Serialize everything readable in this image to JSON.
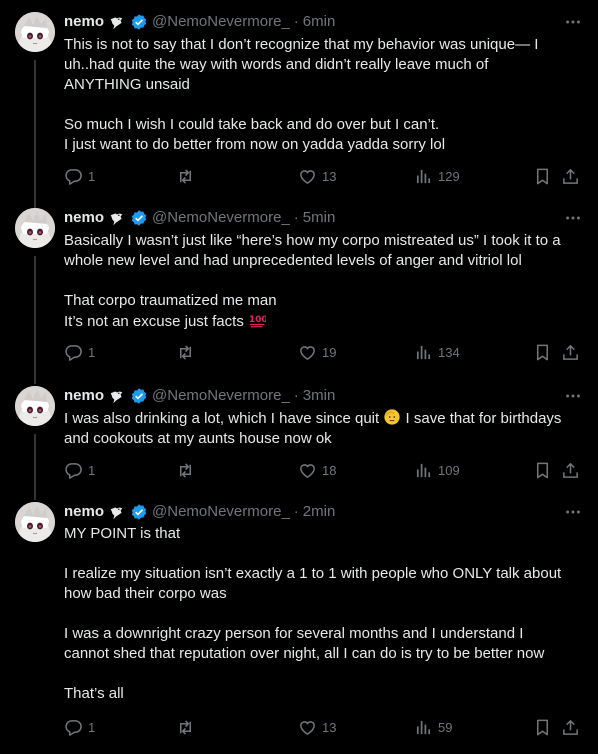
{
  "tweets": [
    {
      "name": "nemo",
      "handle": "@NemoNevermore_",
      "dot": "·",
      "time": "6min",
      "lines": [
        "This is not to say that I don’t recognize that my behavior was unique— I",
        "uh..had quite the way with words and didn’t really leave much of",
        "ANYTHING unsaid",
        "",
        "So much I wish I could take back and do over but I can’t.",
        "I just want to do better from now on yadda yadda sorry lol"
      ],
      "replies": "1",
      "likes": "13",
      "views": "129"
    },
    {
      "name": "nemo",
      "handle": "@NemoNevermore_",
      "dot": "·",
      "time": "5min",
      "lines": [
        "Basically I wasn’t just like “here’s how my corpo mistreated us” I took it to a",
        "whole new level and had unprecedented levels of anger and vitriol lol",
        "",
        "That corpo traumatized me man",
        "It’s not an excuse just facts"
      ],
      "emoji_hundred": "💯",
      "replies": "1",
      "likes": "19",
      "views": "134"
    },
    {
      "name": "nemo",
      "handle": "@NemoNevermore_",
      "dot": "·",
      "time": "3min",
      "line1_a": "I was also drinking a lot, which I have since quit",
      "line1_b": "I save that for birthdays",
      "line2": "and cookouts at my aunts house now ok",
      "emoji_face": "🫡",
      "replies": "1",
      "likes": "18",
      "views": "109"
    },
    {
      "name": "nemo",
      "handle": "@NemoNevermore_",
      "dot": "·",
      "time": "2min",
      "lines": [
        "MY POINT is that",
        "",
        "I realize my situation isn’t exactly a 1 to 1 with people who ONLY talk about",
        "how bad their corpo was",
        "",
        "I was a downright crazy person for several months and I understand I",
        "cannot shed that reputation over night, all I can do is try to be better now",
        "",
        "That’s all"
      ],
      "replies": "1",
      "likes": "13",
      "views": "59"
    }
  ],
  "colors": {
    "background": "#000000",
    "text": "#e7e9ea",
    "muted": "#71767b",
    "verified": "#1d9bf0",
    "rail": "#333639"
  },
  "icons": [
    "crow-icon",
    "verified-badge-icon",
    "more-icon",
    "reply-icon",
    "retweet-icon",
    "like-icon",
    "views-icon",
    "bookmark-icon",
    "share-icon"
  ]
}
